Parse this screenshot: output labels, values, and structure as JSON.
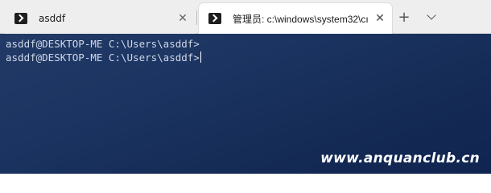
{
  "tabs": [
    {
      "title": "asddf",
      "icon": "powershell-icon",
      "active": false
    },
    {
      "title": "管理员: c:\\windows\\system32\\cı",
      "icon": "powershell-icon",
      "active": true
    }
  ],
  "tabbar": {
    "close_glyph": "✕",
    "new_tab_glyph": "+",
    "dropdown_icon": "chevron-down-icon"
  },
  "terminal": {
    "lines": [
      "asddf@DESKTOP-ME C:\\Users\\asddf>",
      "asddf@DESKTOP-ME C:\\Users\\asddf>"
    ],
    "background_color": "#1b3461",
    "text_color": "#cfd8e8"
  },
  "watermark": "www.anquanclub.cn"
}
